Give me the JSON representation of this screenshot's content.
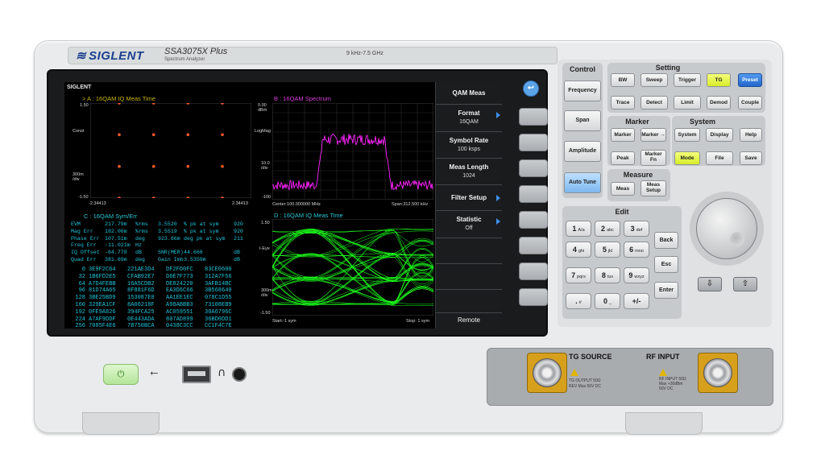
{
  "header": {
    "brand": "SIGLENT",
    "model": "SSA3075X Plus",
    "model_subtitle": "Spectrum Analyzer",
    "freq_range": "9 kHz-7.5 GHz"
  },
  "screen": {
    "brand": "SIGLENT",
    "panel_a": {
      "title": ">  A : 16QAM  IQ Meas Time",
      "y_top": "1.50",
      "y_mid": "Const",
      "y_div": "300m /div",
      "y_bot": "-1.50",
      "x_left": "-2.34413",
      "x_right": "2.34413",
      "points": [
        [
          -1.5,
          1.5
        ],
        [
          -0.5,
          1.5
        ],
        [
          0.5,
          1.5
        ],
        [
          1.5,
          1.5
        ],
        [
          -1.5,
          0.5
        ],
        [
          -0.5,
          0.5
        ],
        [
          0.5,
          0.5
        ],
        [
          1.5,
          0.5
        ],
        [
          -1.5,
          -0.5
        ],
        [
          -0.5,
          -0.5
        ],
        [
          0.5,
          -0.5
        ],
        [
          1.5,
          -0.5
        ],
        [
          -1.5,
          -1.5
        ],
        [
          -0.5,
          -1.5
        ],
        [
          0.5,
          -1.5
        ],
        [
          1.5,
          -1.5
        ]
      ]
    },
    "panel_b": {
      "title": "B :  16QAM  Spectrum",
      "y_top": "0.00 dBm",
      "y_mid": "LogMag",
      "y_div": "10.0 /div",
      "y_bot": "-100",
      "x_left": "Center:100.000000 MHz",
      "x_right": "Span:312.500 kHz"
    },
    "panel_c": {
      "title": "C :  16QAM  Sym/Err",
      "metrics": [
        [
          "EVM",
          "217.79m",
          "%rms",
          "3.5520",
          "% pk at sym",
          "920"
        ],
        [
          "Mag Err",
          "182.06m",
          "%rms",
          "3.5519",
          "% pk at sym",
          "920"
        ],
        [
          "Phase Err",
          "107.51m",
          "deg",
          "923.66m",
          "deg pk at sym",
          "211"
        ],
        [
          "Freq Err",
          "-11.021m",
          "Hz",
          "",
          "",
          ""
        ],
        [
          "IQ Offset",
          "-64.778",
          "dB",
          "SNR(MER)",
          "44.666",
          "dB"
        ],
        [
          "Quad Err",
          "381.69m",
          "deg",
          "Gain Imb",
          "3.5359m",
          "dB"
        ]
      ],
      "symbols": [
        [
          "0",
          "3E9F2C64",
          "221AE3D4",
          "DF2FD0FC",
          "83CE0600"
        ],
        [
          "32",
          "1B6FD2E5",
          "CFAB92E7",
          "D6E7F773",
          "312A7F56"
        ],
        [
          "64",
          "A7D4FEBB",
          "16A5CDB2",
          "DE824220",
          "3AFB14BC"
        ],
        [
          "96",
          "81D74A65",
          "8F881F6D",
          "EA3D6C66",
          "3B568640"
        ],
        [
          "128",
          "3BE25BD9",
          "153087E0",
          "AA1EE1EC",
          "078C1D55"
        ],
        [
          "160",
          "329EA1CF",
          "8A06218F",
          "A98ABBB3",
          "73108EB9"
        ],
        [
          "192",
          "0FE9A826",
          "394FCA25",
          "AC059551",
          "30A6796C"
        ],
        [
          "224",
          "A7AF9DDF",
          "0E443ADA",
          "807AD899",
          "36BD0DD1"
        ],
        [
          "256",
          "7085F4E6",
          "7B750BCA",
          "0438C3CC",
          "CC1F4C7E"
        ]
      ]
    },
    "panel_d": {
      "title": "D :  16QAM  IQ Meas Time",
      "y_top": "1.50",
      "y_mid": "I-Eye",
      "y_div": "300m /div",
      "y_bot": "-1.50",
      "x_left": "Start:-1 sym",
      "x_right": "Stop: 1 sym"
    }
  },
  "softmenu": {
    "title": "QAM Meas",
    "items": [
      {
        "label": "Format",
        "value": "16QAM"
      },
      {
        "label": "Symbol Rate",
        "value": "100 ksps"
      },
      {
        "label": "Meas Length",
        "value": "1024"
      },
      {
        "label": "Filter Setup",
        "value": ""
      },
      {
        "label": "Statistic",
        "value": "Off"
      }
    ],
    "remote": "Remote"
  },
  "control": {
    "label": "Control",
    "frequency": "Frequency",
    "span": "Span",
    "amplitude": "Amplitude",
    "auto_tune": "Auto Tune"
  },
  "setting": {
    "label": "Setting",
    "row1": [
      "BW",
      "Sweep",
      "Trigger",
      "TG",
      "Preset"
    ],
    "row2": [
      "Trace",
      "Detect",
      "Limit",
      "Demod",
      "Couple"
    ]
  },
  "marker": {
    "label": "Marker",
    "marker": "Marker",
    "marker_arrow": "Marker →",
    "peak": "Peak",
    "marker_fn": "Marker Fn"
  },
  "system": {
    "label": "System",
    "row1": [
      "System",
      "Display",
      "Help"
    ],
    "row2": [
      "Mode",
      "File",
      "Save"
    ]
  },
  "measure": {
    "label": "Measure",
    "meas": "Meas",
    "meas_setup": "Meas Setup"
  },
  "edit": {
    "label": "Edit",
    "keys": [
      [
        "1",
        "A/a"
      ],
      [
        "2",
        "abc"
      ],
      [
        "3",
        "def"
      ],
      [
        "4",
        "ghi"
      ],
      [
        "5",
        "jkl"
      ],
      [
        "6",
        "mno"
      ],
      [
        "7",
        "pqrs"
      ],
      [
        "8",
        "tuv"
      ],
      [
        "9",
        "wxyz"
      ],
      [
        ".",
        "#"
      ],
      [
        "0",
        "_"
      ],
      [
        "+/-",
        ""
      ]
    ],
    "back": "Back",
    "esc": "Esc",
    "enter": "Enter",
    "down": "⇩",
    "up": "⇧"
  },
  "connectors": {
    "tg_title": "TG SOURCE",
    "tg_note1": "TG OUTPUT 50Ω",
    "tg_note2": "REV Max 50V DC",
    "rf_title": "RF INPUT",
    "rf_note1": "RF INPUT 50Ω",
    "rf_note2": "Max +30dBm",
    "rf_note3": "50V DC"
  },
  "colors": {
    "accent_blue": "#2f78d8",
    "tg_yellow": "#e4f43c",
    "trace_green": "#1bff1b",
    "trace_magenta": "#ff25ff",
    "header_yellow": "#c8b400",
    "header_magenta": "#d83adb",
    "header_cyan": "#27c7d3"
  },
  "icons": {
    "power": "power-icon",
    "usb": "usb-icon",
    "headphone": "headphone-icon",
    "home": "home-icon"
  }
}
